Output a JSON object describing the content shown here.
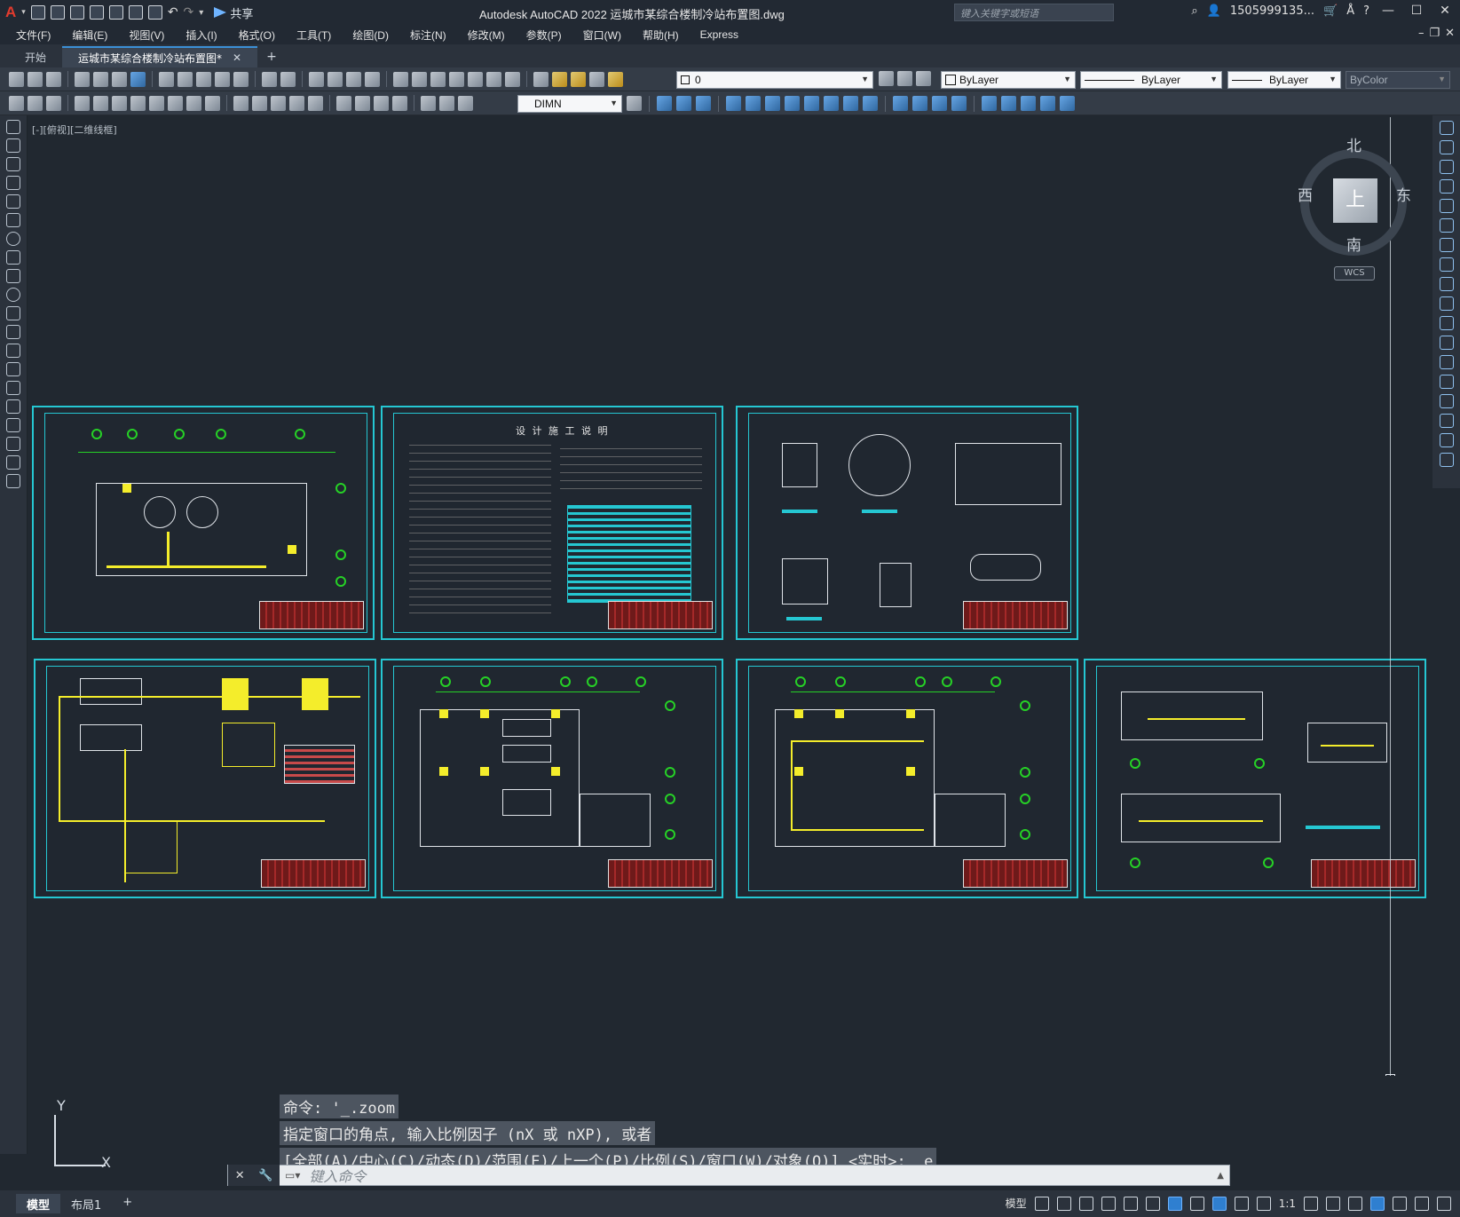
{
  "app": {
    "logo": "A",
    "title": "Autodesk AutoCAD 2022    运城市某综合楼制冷站布置图.dwg",
    "search_placeholder": "键入关键字或短语",
    "user": "1505999135...",
    "share": "共享"
  },
  "menu": [
    "文件(F)",
    "编辑(E)",
    "视图(V)",
    "插入(I)",
    "格式(O)",
    "工具(T)",
    "绘图(D)",
    "标注(N)",
    "修改(M)",
    "参数(P)",
    "窗口(W)",
    "帮助(H)",
    "Express"
  ],
  "tabs": {
    "start": "开始",
    "active": "运城市某综合楼制冷站布置图*",
    "close": "✕",
    "add": "+"
  },
  "layer": {
    "current": "0"
  },
  "properties": {
    "color": "ByLayer",
    "linetype": "ByLayer",
    "lineweight": "ByLayer",
    "plotstyle": "ByColor"
  },
  "dimstyle": "DIMN",
  "viewport": {
    "label": "[-][俯视][二维线框]"
  },
  "viewcube": {
    "north": "北",
    "south": "南",
    "east": "东",
    "west": "西",
    "top": "上",
    "wcs": "WCS"
  },
  "sheet_notes": {
    "title": "设 计 施 工 说 明"
  },
  "command": {
    "lines": [
      "命令: '_.zoom",
      "指定窗口的角点, 输入比例因子 (nX 或 nXP), 或者",
      "[全部(A)/中心(C)/动态(D)/范围(E)/上一个(P)/比例(S)/窗口(W)/对象(O)] <实时>: _e"
    ],
    "placeholder": "键入命令"
  },
  "ucs": {
    "x": "X",
    "y": "Y"
  },
  "layouts": [
    "模型",
    "布局1",
    "+"
  ],
  "status": {
    "model": "模型",
    "scale": "1:1"
  },
  "colors": {
    "sheet_border": "#25c7d2",
    "pipe": "#f4ed2b",
    "grid": "#26d126",
    "background": "#212830"
  }
}
